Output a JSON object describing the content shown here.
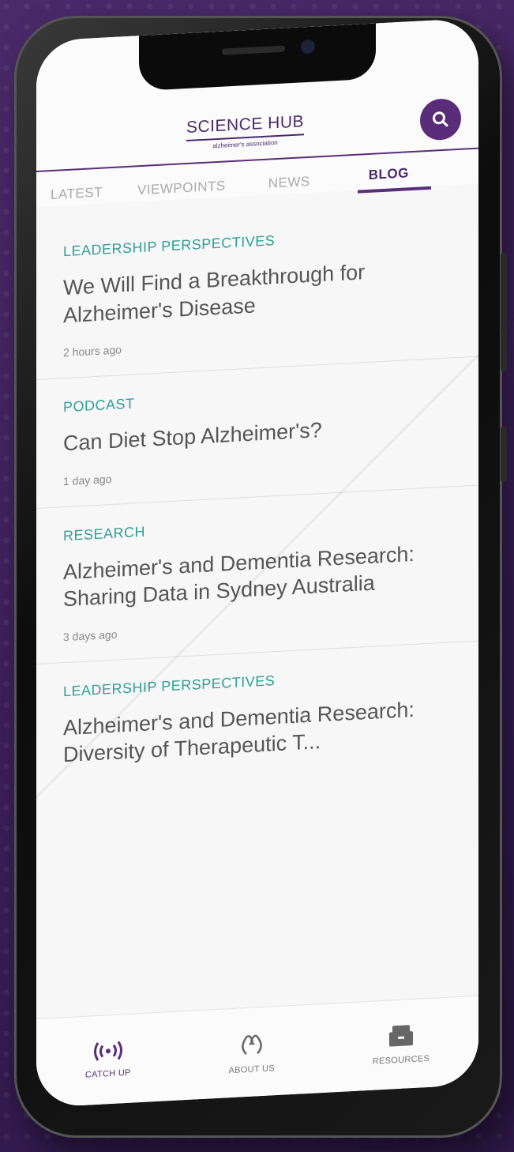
{
  "app": {
    "logo_title": "SCIENCE HUB",
    "logo_subtitle": "alzheimer's association"
  },
  "search": {
    "icon": "search-icon"
  },
  "tabs": [
    {
      "label": "LATEST",
      "active": false
    },
    {
      "label": "VIEWPOINTS",
      "active": false
    },
    {
      "label": "NEWS",
      "active": false
    },
    {
      "label": "BLOG",
      "active": true
    }
  ],
  "feed": [
    {
      "category": "LEADERSHIP PERSPECTIVES",
      "title": "We Will Find a Breakthrough for Alzheimer's Disease",
      "time": "2 hours ago"
    },
    {
      "category": "PODCAST",
      "title": "Can Diet Stop Alzheimer's?",
      "time": "1 day ago"
    },
    {
      "category": "RESEARCH",
      "title": "Alzheimer's and Dementia Research: Sharing Data in Sydney Australia",
      "time": "3 days ago"
    },
    {
      "category": "LEADERSHIP PERSPECTIVES",
      "title": "Alzheimer's and Dementia Research: Diversity of Therapeutic T...",
      "time": ""
    }
  ],
  "tabbar": [
    {
      "label": "CATCH UP",
      "icon": "broadcast-icon",
      "active": true
    },
    {
      "label": "ABOUT US",
      "icon": "association-logo-icon",
      "active": false
    },
    {
      "label": "RESOURCES",
      "icon": "file-box-icon",
      "active": false
    }
  ],
  "colors": {
    "brand_purple": "#5a2d7a",
    "category_teal": "#2e9f99",
    "background": "#3a1f58"
  }
}
